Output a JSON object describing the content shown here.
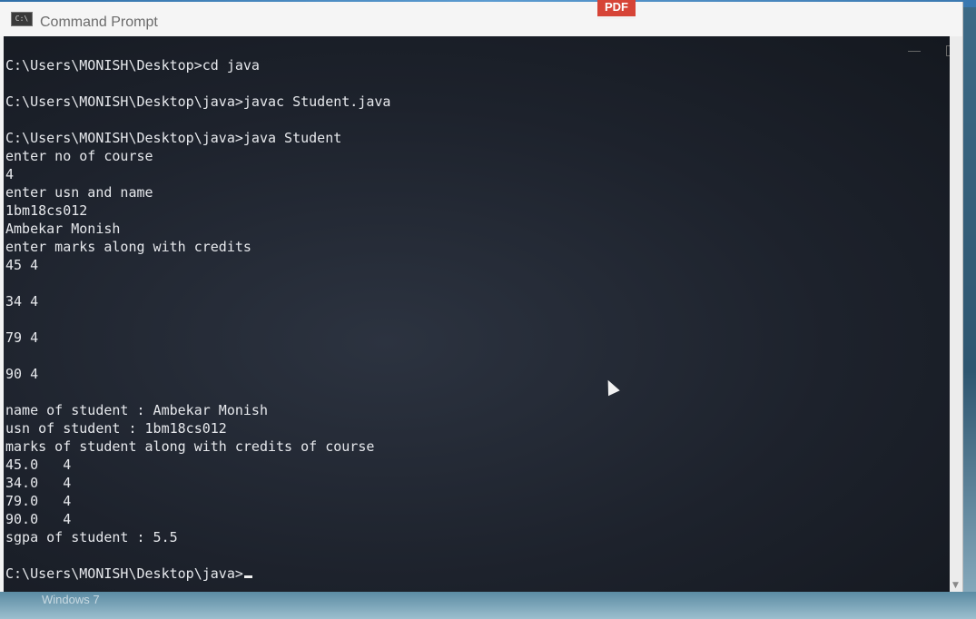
{
  "desktop": {
    "pdf_icon_label": "PDF",
    "os_label": "Windows 7"
  },
  "window": {
    "title": "Command Prompt",
    "icon_text": "C:\\"
  },
  "console": {
    "lines": [
      "C:\\Users\\MONISH\\Desktop>cd java",
      "",
      "C:\\Users\\MONISH\\Desktop\\java>javac Student.java",
      "",
      "C:\\Users\\MONISH\\Desktop\\java>java Student",
      "enter no of course",
      "4",
      "enter usn and name",
      "1bm18cs012",
      "Ambekar Monish",
      "enter marks along with credits",
      "45 4",
      "",
      "34 4",
      "",
      "79 4",
      "",
      "90 4",
      "",
      "name of student : Ambekar Monish",
      "usn of student : 1bm18cs012",
      "marks of student along with credits of course",
      "45.0   4",
      "34.0   4",
      "79.0   4",
      "90.0   4",
      "sgpa of student : 5.5",
      "",
      "C:\\Users\\MONISH\\Desktop\\java>"
    ]
  },
  "colors": {
    "console_text": "#e6e8ec",
    "console_bg": "#1d222c",
    "titlebar_bg": "#f5f5f5",
    "pdf_red": "#d64437"
  }
}
